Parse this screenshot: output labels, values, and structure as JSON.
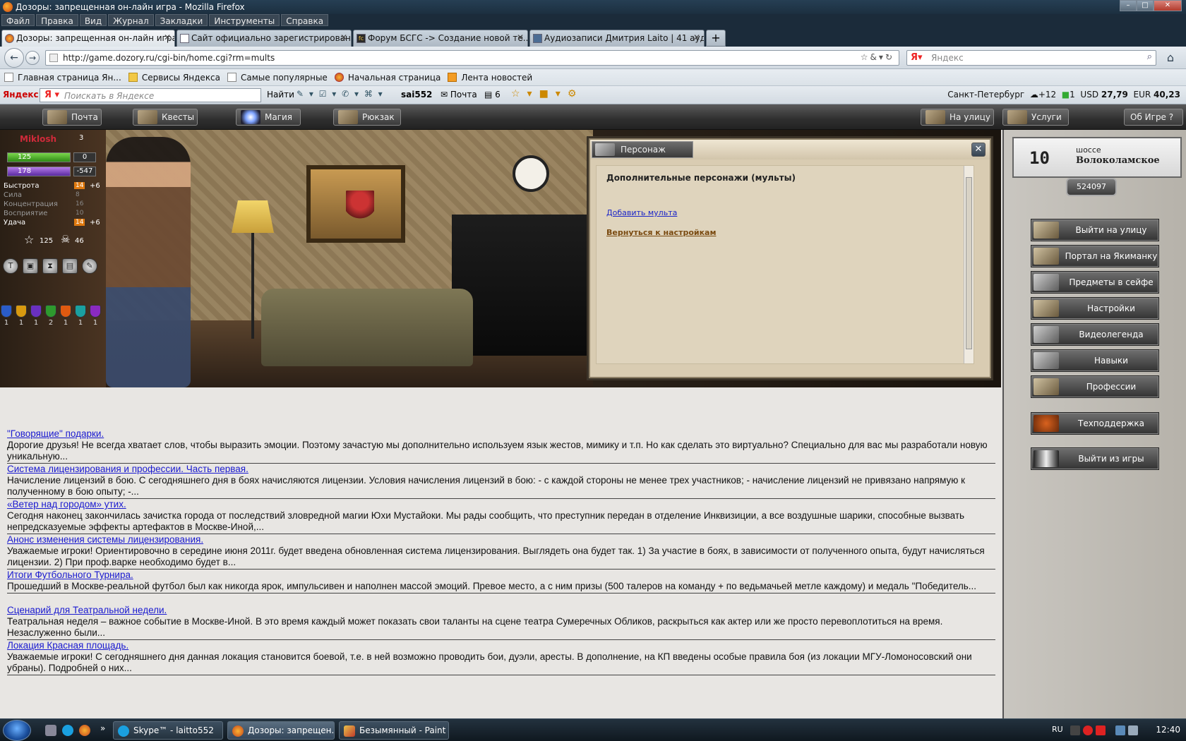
{
  "window": {
    "title": "Дозоры: запрещенная он-лайн игра - Mozilla Firefox"
  },
  "menu": [
    "Файл",
    "Правка",
    "Вид",
    "Журнал",
    "Закладки",
    "Инструменты",
    "Справка"
  ],
  "tabs": [
    {
      "label": "Дозоры: запрещенная он-лайн игра",
      "active": true
    },
    {
      "label": "Сайт официально зарегистрирован...",
      "active": false
    },
    {
      "label": "Форум БСГС -> Создание новой те...",
      "active": false
    },
    {
      "label": "Аудиозаписи Дмитрия Laito | 41 ауд...",
      "active": false
    }
  ],
  "nav": {
    "url": "http://game.dozory.ru/cgi-bin/home.cgi?rm=mults",
    "search_placeholder": "Яндекс"
  },
  "bookmarks": [
    {
      "label": "Главная страница Ян...",
      "icon": "page"
    },
    {
      "label": "Сервисы Яндекса",
      "icon": "folder"
    },
    {
      "label": "Самые популярные",
      "icon": "page"
    },
    {
      "label": "Начальная страница",
      "icon": "ff"
    },
    {
      "label": "Лента новостей",
      "icon": "rss"
    }
  ],
  "yandex_bar": {
    "brand": "Яндекс",
    "placeholder": "Поискать в Яндексе",
    "find": "Найти",
    "user": "sai552",
    "mail": "Почта",
    "count": "6",
    "city": "Санкт-Петербург",
    "temp": "+12",
    "traffic": "1",
    "usd_label": "USD",
    "usd": "27,79",
    "eur_label": "EUR",
    "eur": "40,23"
  },
  "game_nav": {
    "left": [
      "Почта",
      "Квесты",
      "Магия",
      "Рюкзак"
    ],
    "right": [
      "На улицу",
      "Услуги",
      "Об Игре"
    ]
  },
  "character": {
    "name": "Miklosh",
    "level": "3",
    "hp": "125",
    "hp_extra": "0",
    "mp": "178",
    "mp_extra": "-547",
    "stats": [
      {
        "label": "Быстрота",
        "value": "14",
        "bonus": "+6",
        "dim": false
      },
      {
        "label": "Сила",
        "value": "8",
        "bonus": "",
        "dim": true
      },
      {
        "label": "Концентрация",
        "value": "16",
        "bonus": "",
        "dim": true
      },
      {
        "label": "Восприятие",
        "value": "10",
        "bonus": "",
        "dim": true
      },
      {
        "label": "Удача",
        "value": "14",
        "bonus": "+6",
        "dim": false
      }
    ],
    "rank": "125",
    "kills": "46",
    "shields": [
      "1",
      "1",
      "1",
      "2",
      "1",
      "1",
      "1"
    ]
  },
  "dialog": {
    "tab": "Персонаж",
    "title": "Дополнительные персонажи (мульты)",
    "add_link": "Добавить мульта",
    "back_link": "Вернуться к настройкам"
  },
  "news": [
    {
      "title": "\"Говорящие\" подарки.",
      "text": "Дорогие друзья! Не всегда хватает слов, чтобы выразить эмоции. Поэтому зачастую мы дополнительно используем язык жестов, мимику и т.п. Но как сделать это виртуально? Специально для вас мы разработали новую уникальную..."
    },
    {
      "title": "Система лицензирования и профессии. Часть первая.",
      "text": "Начисление лицензий в бою. С сегодняшнего дня в боях начисляются лицензии. Условия начисления лицензий в бою: - с каждой стороны не менее трех участников; - начисление лицензий не привязано напрямую к полученному в бою опыту; -..."
    },
    {
      "title": "«Ветер над городом» утих.",
      "text": "Сегодня наконец закончилась зачистка города от последствий зловредной магии Юхи Мустайоки. Мы рады сообщить, что преступник передан в отделение Инквизиции, а все воздушные шарики, способные вызвать непредсказуемые эффекты артефактов в Москве-Иной,..."
    },
    {
      "title": "Анонс изменения системы лицензирования.",
      "text": "Уважаемые игроки! Ориентировочно в середине июня 2011г. будет введена обновленная система лицензирования. Выглядеть она будет так. 1) За участие в боях, в зависимости от полученного опыта, будут начисляться лицензии. 2) При проф.варке необходимо будет в..."
    },
    {
      "title": "Итоги Футбольного Турнира.",
      "text": "Прошедший в Москве-реальной футбол был как никогда ярок, импульсивен и наполнен массой эмоций. Превое место, а с ним призы (500 талеров на команду + по ведьмачьей метле каждому) и медаль \"Победитель..."
    },
    {
      "title": "Сценарий для Театральной недели.",
      "text": "Театральная неделя – важное событие в Москве-Иной. В это время каждый может показать свои таланты на сцене театра Сумеречных Обликов, раскрыться как актер или же просто перевоплотиться на время. Незаслуженно были..."
    },
    {
      "title": "Локация Красная площадь.",
      "text": "Уважаемые игроки! С сегодняшнего дня данная локация становится боевой, т.е. в ней возможно проводить бои, дуэли, аресты. В дополнение, на КП введены особые правила боя (из локации МГУ-Ломоносовский они убраны). Подробней о них..."
    }
  ],
  "location": {
    "number": "10",
    "sub": "шоссе",
    "name": "Волоколамское",
    "id": "524097"
  },
  "panel_buttons": [
    {
      "label": "Выйти на улицу",
      "icon": "street"
    },
    {
      "label": "Портал на Якиманку",
      "icon": "portal"
    },
    {
      "label": "Предметы в сейфе",
      "icon": "safe"
    },
    {
      "label": "Настройки",
      "icon": "settings"
    },
    {
      "label": "Видеолегенда",
      "icon": "video"
    },
    {
      "label": "Навыки",
      "icon": "skills"
    },
    {
      "label": "Профессии",
      "icon": "professions"
    },
    {
      "label": "Техподдержка",
      "icon": "support"
    },
    {
      "label": "Выйти из игры",
      "icon": "exit"
    }
  ],
  "taskbar": {
    "tasks": [
      {
        "label": "Skype™ - laitto552",
        "active": false
      },
      {
        "label": "Дозоры: запрещен...",
        "active": true
      },
      {
        "label": "Безымянный - Paint",
        "active": false
      }
    ],
    "lang": "RU",
    "clock": "12:40"
  },
  "colors": {
    "link": "#1a1ad0",
    "char_name": "#d02a3a",
    "stat_badge": "#e07a10"
  }
}
